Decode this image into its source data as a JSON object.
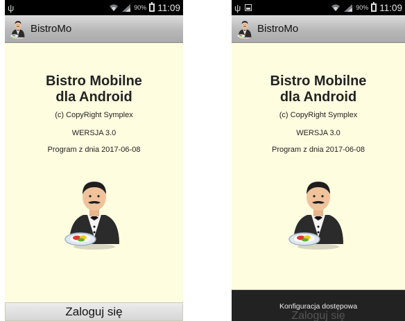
{
  "screens": [
    {
      "status": {
        "usb_symbol": "ψ",
        "battery_pct": "90%",
        "time": "11:09"
      },
      "app_name": "BistroMo",
      "title_line1": "Bistro Mobilne",
      "title_line2": "dla Android",
      "copyright": "(c) CopyRight Symplex",
      "version": "WERSJA 3.0",
      "program_date": "Program z dnia 2017-06-08",
      "login_button": "Zaloguj się"
    },
    {
      "status": {
        "usb_symbol": "ψ",
        "battery_pct": "90%",
        "time": "11:09"
      },
      "app_name": "BistroMo",
      "title_line1": "Bistro Mobilne",
      "title_line2": "dla Android",
      "copyright": "(c) CopyRight Symplex",
      "version": "WERSJA 3.0",
      "program_date": "Program z dnia 2017-06-08",
      "login_button": "Zaloguj się",
      "toast": "Konfiguracja dostępowa"
    }
  ],
  "icons": {
    "usb": "usb-icon",
    "wifi": "wifi-icon",
    "signal": "signal-icon",
    "battery": "battery-icon",
    "image_notification": "image-notification-icon",
    "app_logo": "waiter-icon"
  },
  "colors": {
    "background": "#fffde0",
    "status_bar": "#000000",
    "action_bar": "#c4c4c4",
    "toast": "#222222"
  }
}
